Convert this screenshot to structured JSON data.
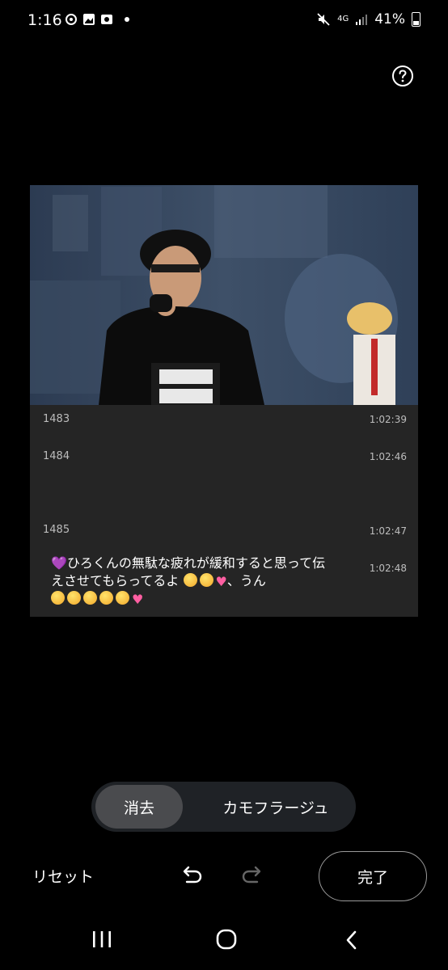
{
  "status_bar": {
    "time": "1:16",
    "network": "4G",
    "battery": "41%"
  },
  "image": {
    "chat_rows": [
      {
        "number": "1483",
        "time": "1:02:39"
      },
      {
        "number": "1484",
        "time": "1:02:46"
      },
      {
        "number": "1485",
        "time": "1:02:47"
      }
    ],
    "message": {
      "time": "1:02:48",
      "text_line1": "ひろくんの無駄な疲れが緩和すると思って伝",
      "text_line2": "えさせてもらってるよ",
      "text_suffix": "、うん"
    }
  },
  "modes": {
    "erase_label": "消去",
    "camouflage_label": "カモフラージュ",
    "selected": "erase"
  },
  "actions": {
    "reset_label": "リセット",
    "done_label": "完了"
  },
  "colors": {
    "background": "#000000",
    "segment_bg": "#1f2226",
    "segment_selected": "#4a4b4e"
  }
}
